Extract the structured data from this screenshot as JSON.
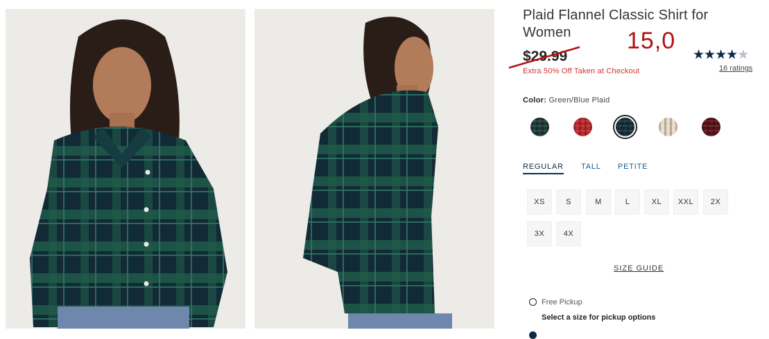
{
  "product": {
    "title": "Plaid Flannel Classic Shirt for Women",
    "handwritten_price": "15,0",
    "original_price": "$29.99",
    "promo_text": "Extra 50% Off Taken at Checkout",
    "rating_stars": 4.5,
    "ratings_link": "16 ratings"
  },
  "color": {
    "label": "Color:",
    "value": "Green/Blue Plaid",
    "swatches": [
      {
        "name": "green-navy-plaid",
        "color": "#1d3b3a"
      },
      {
        "name": "red-plaid",
        "color": "#c0282a"
      },
      {
        "name": "green-blue-plaid",
        "color": "#17303a",
        "selected": true
      },
      {
        "name": "cream-plaid",
        "color": "#e9dcc6"
      },
      {
        "name": "dark-red-plaid",
        "color": "#5a1418"
      }
    ]
  },
  "fit_tabs": [
    "REGULAR",
    "TALL",
    "PETITE"
  ],
  "sizes": [
    "XS",
    "S",
    "M",
    "L",
    "XL",
    "XXL",
    "2X",
    "3X",
    "4X"
  ],
  "size_guide": "SIZE GUIDE",
  "pickup": {
    "option_label": "Free Pickup",
    "note": "Select a size for pickup options"
  },
  "colors": {
    "navy": "#0b2a4a",
    "sale_red": "#b21010",
    "promo_red": "#d1342c",
    "plaid_green": "#1f5a4a"
  }
}
